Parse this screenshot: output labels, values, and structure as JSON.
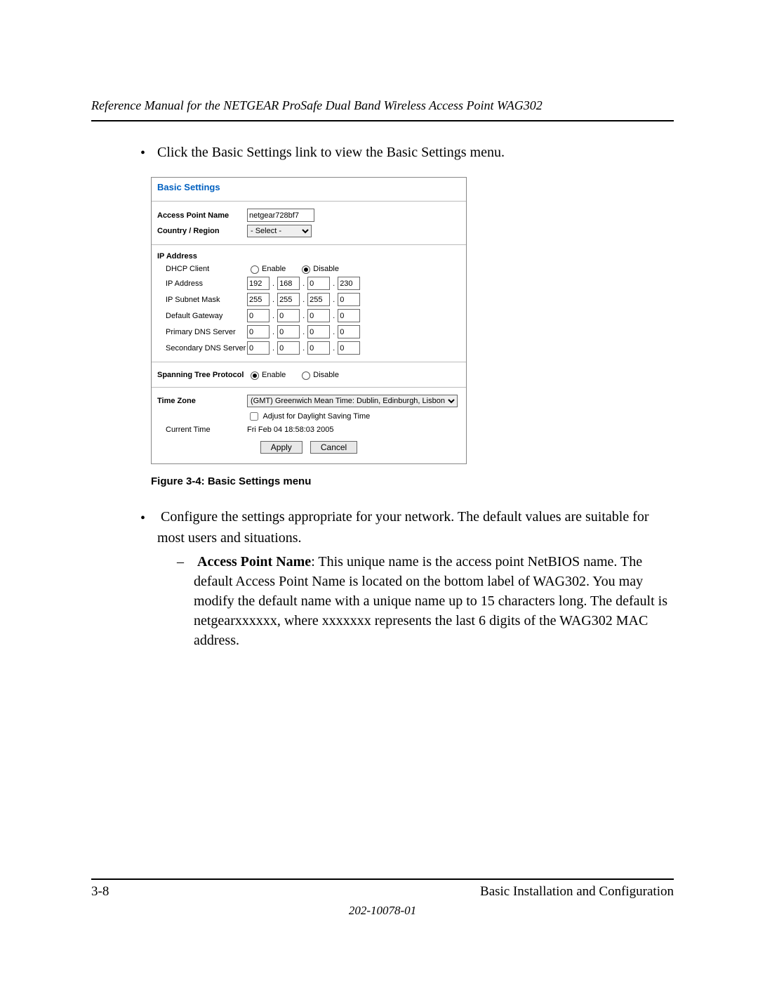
{
  "header": {
    "title": "Reference Manual for the NETGEAR ProSafe Dual Band Wireless Access Point WAG302"
  },
  "body": {
    "bullet1": "Click the Basic Settings link to view the Basic Settings menu.",
    "caption": "Figure 3-4: Basic Settings menu",
    "bullet2": "Configure the settings appropriate for your network. The default values are suitable for most users and situations.",
    "sub1_label": "Access Point Name",
    "sub1_text": ": This unique name is the access point NetBIOS name. The default Access Point Name is located on the bottom label of WAG302. You may modify the default name with a unique name up to 15 characters long. The default is netgearxxxxxx, where xxxxxxx represents the last 6 digits of the WAG302 MAC address."
  },
  "panel": {
    "title": "Basic Settings",
    "ap_name_label": "Access Point Name",
    "ap_name_value": "netgear728bf7",
    "country_label": "Country / Region",
    "country_value": "- Select -",
    "ip_header": "IP Address",
    "dhcp_label": "DHCP Client",
    "enable": "Enable",
    "disable": "Disable",
    "ip_addr_label": "IP Address",
    "ip_addr": [
      "192",
      "168",
      "0",
      "230"
    ],
    "subnet_label": "IP Subnet Mask",
    "subnet": [
      "255",
      "255",
      "255",
      "0"
    ],
    "gateway_label": "Default Gateway",
    "gateway": [
      "0",
      "0",
      "0",
      "0"
    ],
    "pdns_label": "Primary DNS Server",
    "pdns": [
      "0",
      "0",
      "0",
      "0"
    ],
    "sdns_label": "Secondary DNS Server",
    "sdns": [
      "0",
      "0",
      "0",
      "0"
    ],
    "stp_label": "Spanning Tree Protocol",
    "tz_label": "Time Zone",
    "tz_value": "(GMT) Greenwich Mean Time: Dublin, Edinburgh, Lisbon, London",
    "dst_label": "Adjust for Daylight Saving Time",
    "current_time_label": "Current Time",
    "current_time_value": "Fri Feb 04 18:58:03 2005",
    "apply": "Apply",
    "cancel": "Cancel"
  },
  "footer": {
    "page": "3-8",
    "section": "Basic Installation and Configuration",
    "docnum": "202-10078-01"
  }
}
